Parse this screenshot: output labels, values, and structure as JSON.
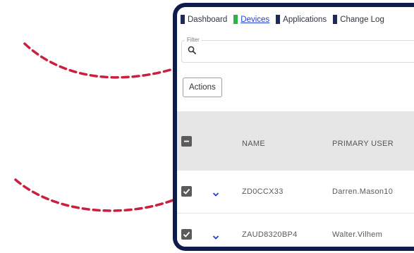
{
  "tabs": [
    {
      "label": "Dashboard",
      "marker_color": "#1e2a55",
      "active": false
    },
    {
      "label": "Devices",
      "marker_color": "#2bb24c",
      "active": true
    },
    {
      "label": "Applications",
      "marker_color": "#1e2a55",
      "active": false
    },
    {
      "label": "Change Log",
      "marker_color": "#1e2a55",
      "active": false
    }
  ],
  "filter": {
    "label": "Filter",
    "value": "",
    "icon": "search-icon"
  },
  "actions": {
    "label": "Actions"
  },
  "table": {
    "columns": [
      "NAME",
      "PRIMARY USER"
    ],
    "rows": [
      {
        "name": "ZD0CCX33",
        "primary_user": "Darren.Mason10",
        "checked": true
      },
      {
        "name": "ZAUD8320BP4",
        "primary_user": "Walter.Vilhem",
        "checked": true
      }
    ]
  },
  "colors": {
    "frame": "#0e1b4d",
    "arrow": "#cc1f3f",
    "accent": "#1f3fd1",
    "active_tab_marker": "#2bb24c"
  }
}
